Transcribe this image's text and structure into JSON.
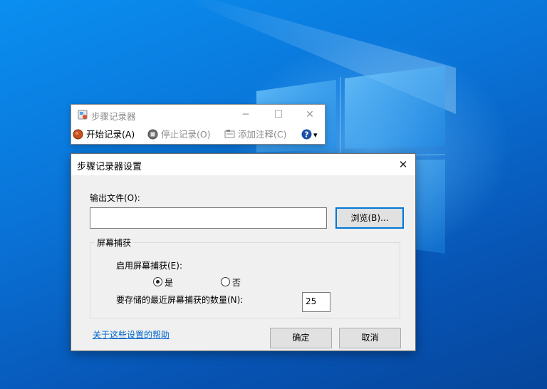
{
  "steps_recorder": {
    "title": "步骤记录器",
    "start_label": "开始记录(A)",
    "stop_label": "停止记录(O)",
    "comment_label": "添加注释(C)",
    "minimize_glyph": "─",
    "maximize_glyph": "☐",
    "close_glyph": "✕",
    "help_glyph": "?",
    "dropdown_glyph": "▾",
    "icons": [
      "record-icon",
      "stop-icon",
      "add-comment-icon",
      "help-icon"
    ]
  },
  "settings_dialog": {
    "title": "步骤记录器设置",
    "close_glyph": "✕",
    "output_file_label": "输出文件(O):",
    "output_file_value": "",
    "browse_label": "浏览(B)...",
    "screen_capture_group": "屏幕捕获",
    "enable_capture_label": "启用屏幕捕获(E):",
    "yes_label": "是",
    "no_label": "否",
    "selected_option": "是",
    "recent_count_label": "要存储的最近屏幕捕获的数量(N):",
    "recent_count_value": "25",
    "help_link": "关于这些设置的帮助",
    "ok_label": "确定",
    "cancel_label": "取消"
  },
  "colors": {
    "desktop_blue": "#0a74d8",
    "accent": "#0078d7",
    "link": "#0066cc",
    "dialog_bg": "#f0f0f0"
  }
}
